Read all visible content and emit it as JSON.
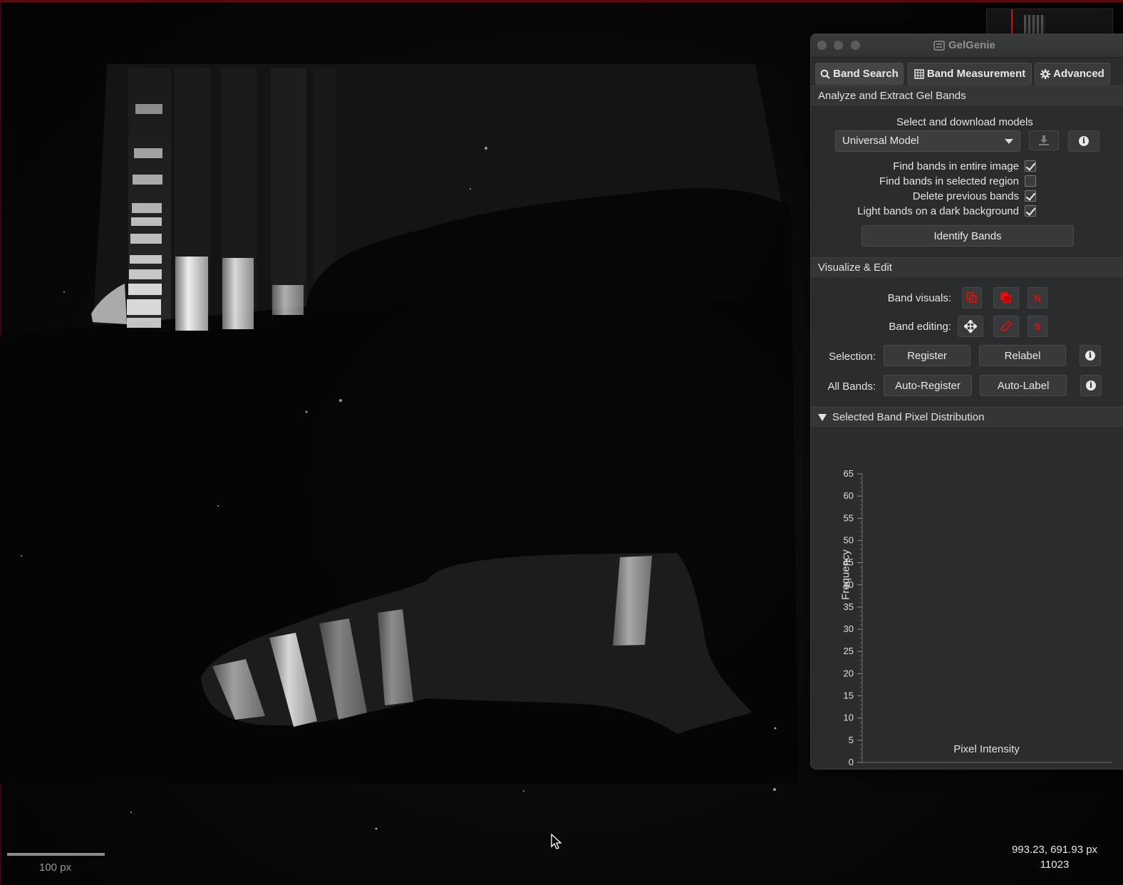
{
  "app": {
    "title": "GelGenie"
  },
  "tabs": [
    {
      "label": "Band Search",
      "icon": "search-icon",
      "active": true
    },
    {
      "label": "Band Measurement",
      "icon": "table-icon",
      "active": false
    },
    {
      "label": "Advanced",
      "icon": "gear-icon",
      "active": false
    }
  ],
  "analyze": {
    "header": "Analyze and Extract Gel Bands",
    "models_label": "Select and download models",
    "model_selected": "Universal Model",
    "options": [
      {
        "label": "Find bands in entire image",
        "checked": true
      },
      {
        "label": "Find bands in selected region",
        "checked": false
      },
      {
        "label": "Delete previous bands",
        "checked": true
      },
      {
        "label": "Light bands on a dark background",
        "checked": true
      }
    ],
    "identify_button": "Identify Bands"
  },
  "visualize": {
    "header": "Visualize & Edit",
    "band_visuals_label": "Band visuals:",
    "band_editing_label": "Band editing:",
    "selection_label": "Selection:",
    "register_button": "Register",
    "relabel_button": "Relabel",
    "all_bands_label": "All Bands:",
    "auto_register_button": "Auto-Register",
    "auto_label_button": "Auto-Label",
    "visual_icons": [
      "show-outline-icon",
      "fill-outline-icon",
      "name-toggle-icon"
    ],
    "editing_icons": [
      "move-icon",
      "brush-icon",
      "selection-mode-icon"
    ],
    "accent_color": "#e01010",
    "visual_n_letter": "N",
    "editing_s_letter": "S"
  },
  "distribution": {
    "header": "Selected Band Pixel Distribution",
    "collapsed": false
  },
  "chart_data": {
    "type": "bar",
    "title": "",
    "xlabel": "Pixel Intensity",
    "ylabel": "Frequency",
    "ylim": [
      0,
      65
    ],
    "yticks": [
      0,
      5,
      10,
      15,
      20,
      25,
      30,
      35,
      40,
      45,
      50,
      55,
      60,
      65
    ],
    "series": []
  },
  "viewer": {
    "scalebar_label": "100 px",
    "cursor_coords": "993.23, 691.93 px",
    "pixel_value": "11023"
  }
}
